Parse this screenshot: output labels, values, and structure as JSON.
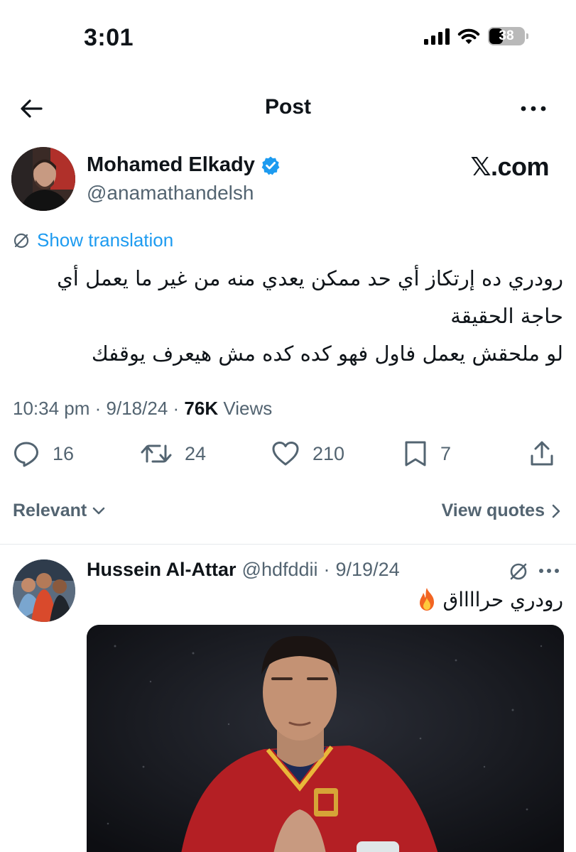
{
  "status_bar": {
    "time": "3:01",
    "battery": "38"
  },
  "header": {
    "title": "Post"
  },
  "post": {
    "author": {
      "name": "Mohamed Elkady",
      "handle": "@anamathandelsh",
      "verified": true
    },
    "watermark": "𝕏.com",
    "translation_label": "Show translation",
    "text_lines": [
      "رودري ده إرتكاز أي حد ممكن يعدي منه من غير ما يعمل أي",
      "حاجة الحقيقة",
      "لو ملحقش يعمل فاول فهو كده كده مش هيعرف يوقفك"
    ],
    "time": "10:34 pm",
    "date": "9/18/24",
    "views_count": "76K",
    "views_label": "Views",
    "stats": {
      "replies": "16",
      "reposts": "24",
      "likes": "210",
      "bookmarks": "7"
    }
  },
  "sort": {
    "label": "Relevant",
    "view_quotes": "View quotes"
  },
  "reply": {
    "name": "Hussein Al-Attar",
    "handle": "@hdfddii",
    "date": "9/19/24",
    "text": "رودري حرااااق"
  },
  "colors": {
    "accent": "#1d9bf0",
    "muted": "#536471",
    "text": "#0f1419",
    "shirt": "#b41f24"
  }
}
